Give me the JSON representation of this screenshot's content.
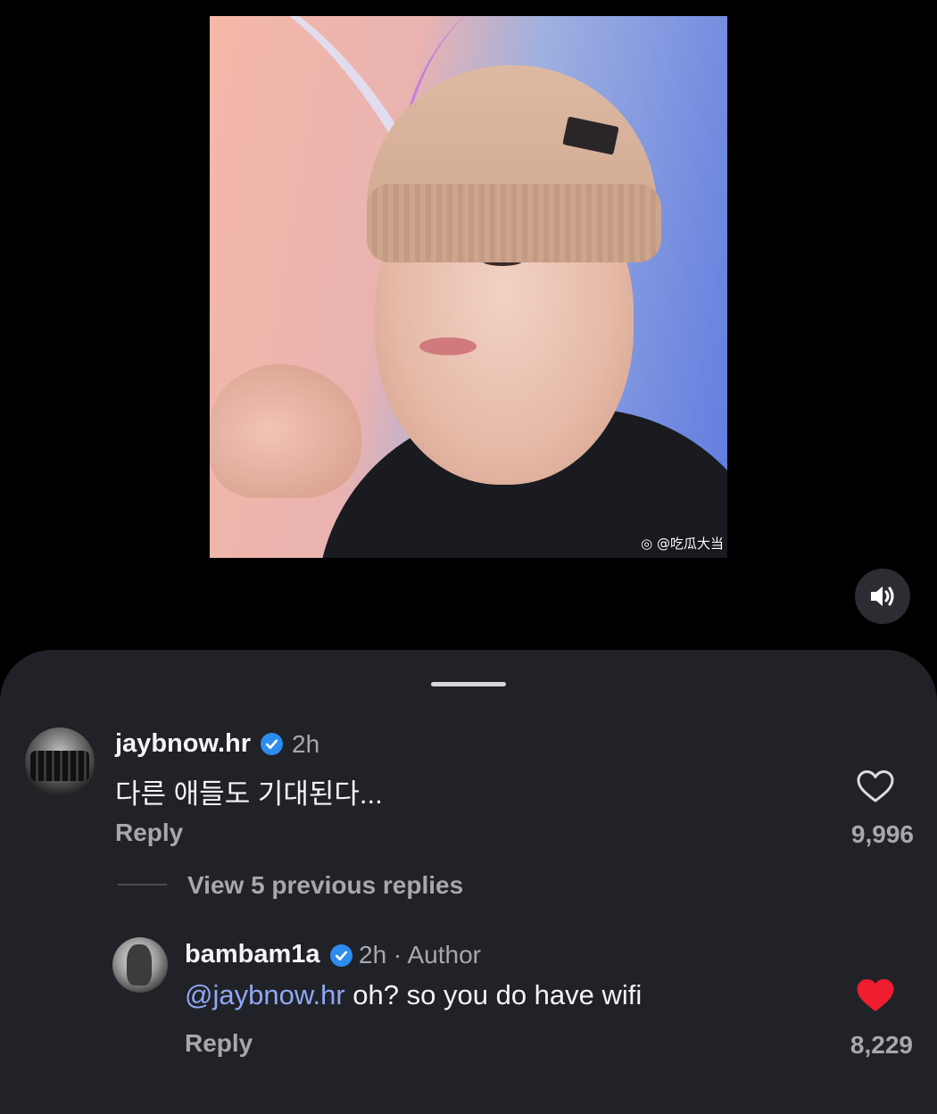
{
  "video": {
    "watermark": "@吃瓜大当"
  },
  "comments": [
    {
      "username": "jaybnow.hr",
      "time": "2h",
      "author_tag": "",
      "text": "다른 애들도 기대된다...",
      "reply_label": "Reply",
      "likes": "9,996",
      "liked": false
    },
    {
      "username": "bambam1a",
      "time": "2h · Author",
      "mention": "@jaybnow.hr",
      "text": " oh? so you do have wifi",
      "reply_label": "Reply",
      "likes": "8,229",
      "liked": true
    }
  ],
  "thread": {
    "view_replies_label": "View 5 previous replies"
  },
  "colors": {
    "like_active": "#ee1d2f",
    "verified": "#2d8cf0",
    "mention": "#8ea8f5"
  }
}
